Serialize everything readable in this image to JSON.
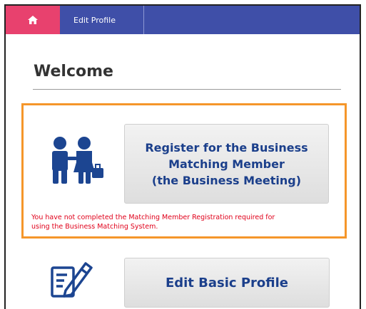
{
  "header": {
    "home_icon": "home-icon",
    "breadcrumb": "Edit Profile",
    "colors": {
      "bar": "#3f4fa8",
      "home": "#e8416e"
    }
  },
  "main": {
    "title": "Welcome",
    "registration": {
      "button_lines": [
        "Register for the Business",
        "Matching Member",
        "(the Business Meeting)"
      ],
      "warning_lines": [
        "You have not completed the Matching Member Registration required for",
        "using the Business Matching System."
      ],
      "icon": "business-people-icon",
      "highlight_color": "#f5962a",
      "warning_color": "#e0001a"
    },
    "edit_profile": {
      "button_label": "Edit Basic Profile",
      "icon": "edit-document-icon"
    }
  }
}
